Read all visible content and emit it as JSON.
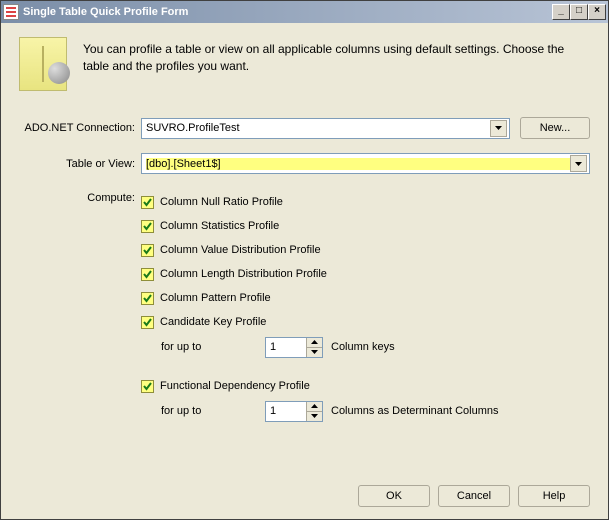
{
  "title": "Single Table Quick Profile Form",
  "intro": "You can profile a table or view on all applicable columns using default settings. Choose the table and the profiles you want.",
  "labels": {
    "connection": "ADO.NET Connection:",
    "tableOrView": "Table or View:",
    "compute": "Compute:",
    "forUpTo": "for up to",
    "columnKeys": "Column keys",
    "determinant": "Columns as Determinant Columns"
  },
  "connection": {
    "value": "SUVRO.ProfileTest",
    "newButton": "New..."
  },
  "tableOrView": {
    "value": "[dbo].[Sheet1$]"
  },
  "checks": {
    "nullRatio": "Column Null Ratio Profile",
    "statistics": "Column Statistics Profile",
    "valueDist": "Column Value Distribution Profile",
    "lengthDist": "Column Length Distribution Profile",
    "pattern": "Column Pattern Profile",
    "candidateKey": "Candidate Key Profile",
    "functional": "Functional Dependency Profile"
  },
  "spinners": {
    "columnKeys": "1",
    "determinant": "1"
  },
  "buttons": {
    "ok": "OK",
    "cancel": "Cancel",
    "help": "Help"
  },
  "titlebarButtons": {
    "min": "_",
    "max": "□",
    "close": "×"
  }
}
